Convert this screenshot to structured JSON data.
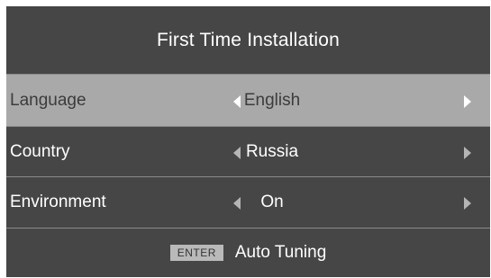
{
  "dialog": {
    "title": "First Time Installation"
  },
  "settings": [
    {
      "label": "Language",
      "value": "English"
    },
    {
      "label": "Country",
      "value": "Russia"
    },
    {
      "label": "Environment",
      "value": "On"
    }
  ],
  "footer": {
    "key_label": "ENTER",
    "action_label": "Auto Tuning"
  },
  "colors": {
    "panel_background": "#464646",
    "selected_row": "#a9a9a9",
    "text": "#ffffff",
    "key_badge": "#b9b9b9"
  }
}
